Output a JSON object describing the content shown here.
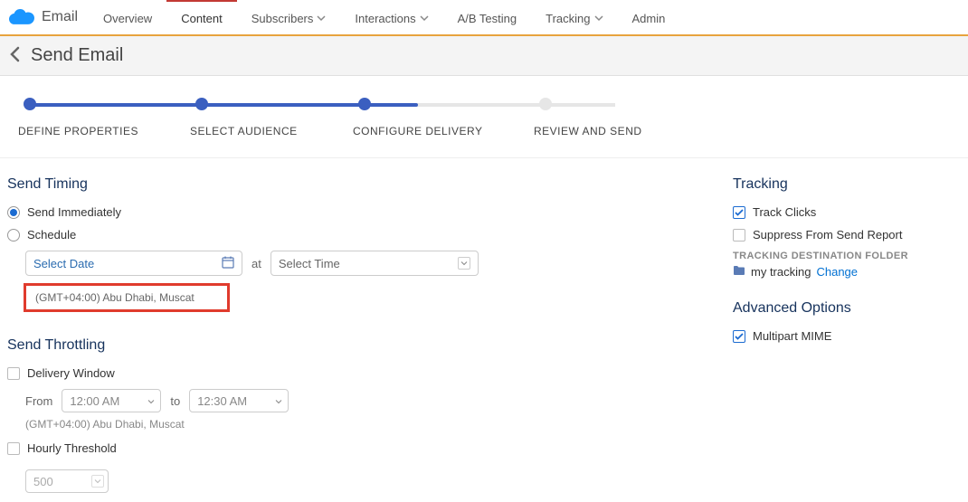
{
  "brand": {
    "product": "Email"
  },
  "nav": {
    "tabs": [
      {
        "label": "Overview",
        "dropdown": false
      },
      {
        "label": "Content",
        "dropdown": false,
        "active": true
      },
      {
        "label": "Subscribers",
        "dropdown": true
      },
      {
        "label": "Interactions",
        "dropdown": true
      },
      {
        "label": "A/B Testing",
        "dropdown": false
      },
      {
        "label": "Tracking",
        "dropdown": true
      },
      {
        "label": "Admin",
        "dropdown": false
      }
    ]
  },
  "page": {
    "title": "Send Email"
  },
  "stepper": {
    "steps": [
      {
        "label": "DEFINE PROPERTIES",
        "done": true
      },
      {
        "label": "SELECT AUDIENCE",
        "done": true
      },
      {
        "label": "CONFIGURE DELIVERY",
        "done": true
      },
      {
        "label": "REVIEW AND SEND",
        "done": false
      }
    ]
  },
  "timing": {
    "title": "Send Timing",
    "options": {
      "immediate": "Send Immediately",
      "schedule": "Schedule"
    },
    "selected": "immediate",
    "date_placeholder": "Select Date",
    "at": "at",
    "time_placeholder": "Select Time",
    "timezone": "(GMT+04:00) Abu Dhabi, Muscat"
  },
  "throttling": {
    "title": "Send Throttling",
    "delivery_window": "Delivery Window",
    "from_label": "From",
    "from_value": "12:00 AM",
    "to_label": "to",
    "to_value": "12:30 AM",
    "timezone": "(GMT+04:00) Abu Dhabi, Muscat",
    "hourly_threshold": "Hourly Threshold",
    "threshold_value": "500"
  },
  "tracking": {
    "title": "Tracking",
    "track_clicks": "Track Clicks",
    "suppress": "Suppress From Send Report",
    "folder_label": "TRACKING DESTINATION FOLDER",
    "folder_name": "my tracking",
    "change": "Change"
  },
  "advanced": {
    "title": "Advanced Options",
    "multipart": "Multipart MIME"
  }
}
